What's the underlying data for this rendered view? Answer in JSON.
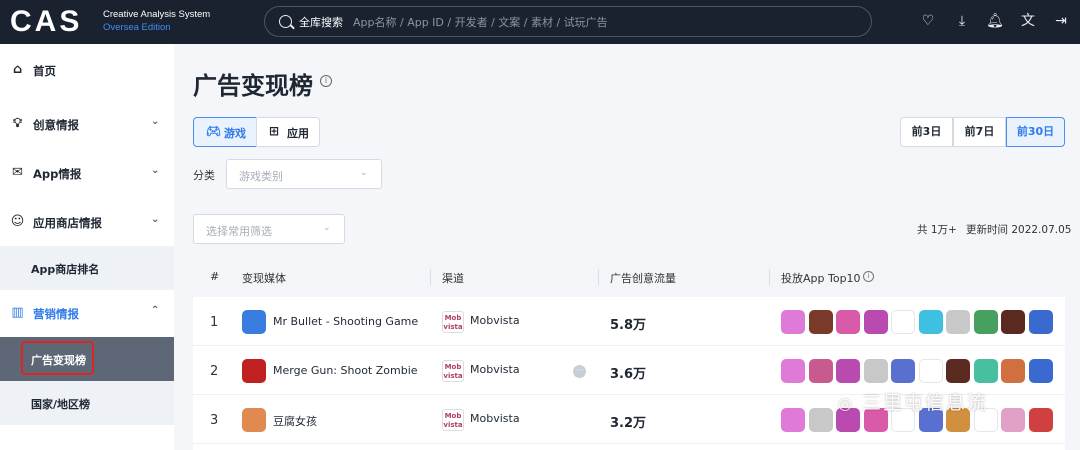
{
  "header": {
    "logo_text": "CAS",
    "logo_line1": "Creative Analysis System",
    "logo_line2": "Oversea Edition",
    "search_label": "全库搜索",
    "search_placeholder": "App名称 / App ID / 开发者 / 文案 / 素材 / 试玩广告",
    "icons": [
      "heart-icon",
      "download-icon",
      "bell-icon",
      "translate-icon",
      "exit-icon"
    ]
  },
  "sidebar": {
    "items": [
      {
        "label": "首页",
        "icon": "home-icon"
      },
      {
        "label": "创意情报",
        "icon": "bulb-icon"
      },
      {
        "label": "App情报",
        "icon": "mail-icon"
      },
      {
        "label": "应用商店情报",
        "icon": "smile-icon"
      },
      {
        "label": "App商店排名"
      },
      {
        "label": "营销情报",
        "icon": "bar-chart-icon"
      },
      {
        "label": "广告变现榜"
      },
      {
        "label": "国家/地区榜"
      }
    ]
  },
  "page": {
    "title": "广告变现榜",
    "type_tabs": [
      "游戏",
      "应用"
    ],
    "date_buttons": [
      "前3日",
      "前7日",
      "前30日"
    ],
    "active_date": "前30日",
    "filter_label": "分类",
    "category_placeholder": "游戏类别",
    "common_filter_placeholder": "选择常用筛选",
    "total": "共 1万+",
    "updated": "更新时间 2022.07.05"
  },
  "table": {
    "headers": [
      "#",
      "变现媒体",
      "渠道",
      "广告创意流量",
      "投放App Top10"
    ],
    "rows": [
      {
        "rank": "1",
        "app": "Mr Bullet - Shooting Game",
        "channel_logo": "Mob vista",
        "channel": "Mobvista",
        "flow": "5.8万",
        "icon_color": "#3a7de0",
        "top10": [
          "#e07ad8",
          "#7a3a2a",
          "#d85aa8",
          "#b84ab0",
          "#ffffff",
          "#3ec0e0",
          "#c8c8c8",
          "#48a060",
          "#5a2a20",
          "#3a6ad0"
        ]
      },
      {
        "rank": "2",
        "app": "Merge Gun: Shoot Zombie",
        "channel_logo": "Mob vista",
        "channel": "Mobvista",
        "flow": "3.6万",
        "icon_color": "#c02020",
        "top10": [
          "#e07ad8",
          "#c85a90",
          "#b84ab0",
          "#c8c8c8",
          "#5a70d0",
          "#ffffff",
          "#5a2a20",
          "#48c0a0",
          "#d07040",
          "#3a6ad0"
        ]
      },
      {
        "rank": "3",
        "app": "豆腐女孩",
        "channel_logo": "Mob vista",
        "channel": "Mobvista",
        "flow": "3.2万",
        "icon_color": "#e08a50",
        "top10": [
          "#e07ad8",
          "#c8c8c8",
          "#b84ab0",
          "#d85aa8",
          "#ffffff",
          "#5a70d0",
          "#d09040",
          "#ffffff",
          "#e0a0c8",
          "#d04040"
        ]
      }
    ]
  },
  "watermark": "三里屯信息流"
}
